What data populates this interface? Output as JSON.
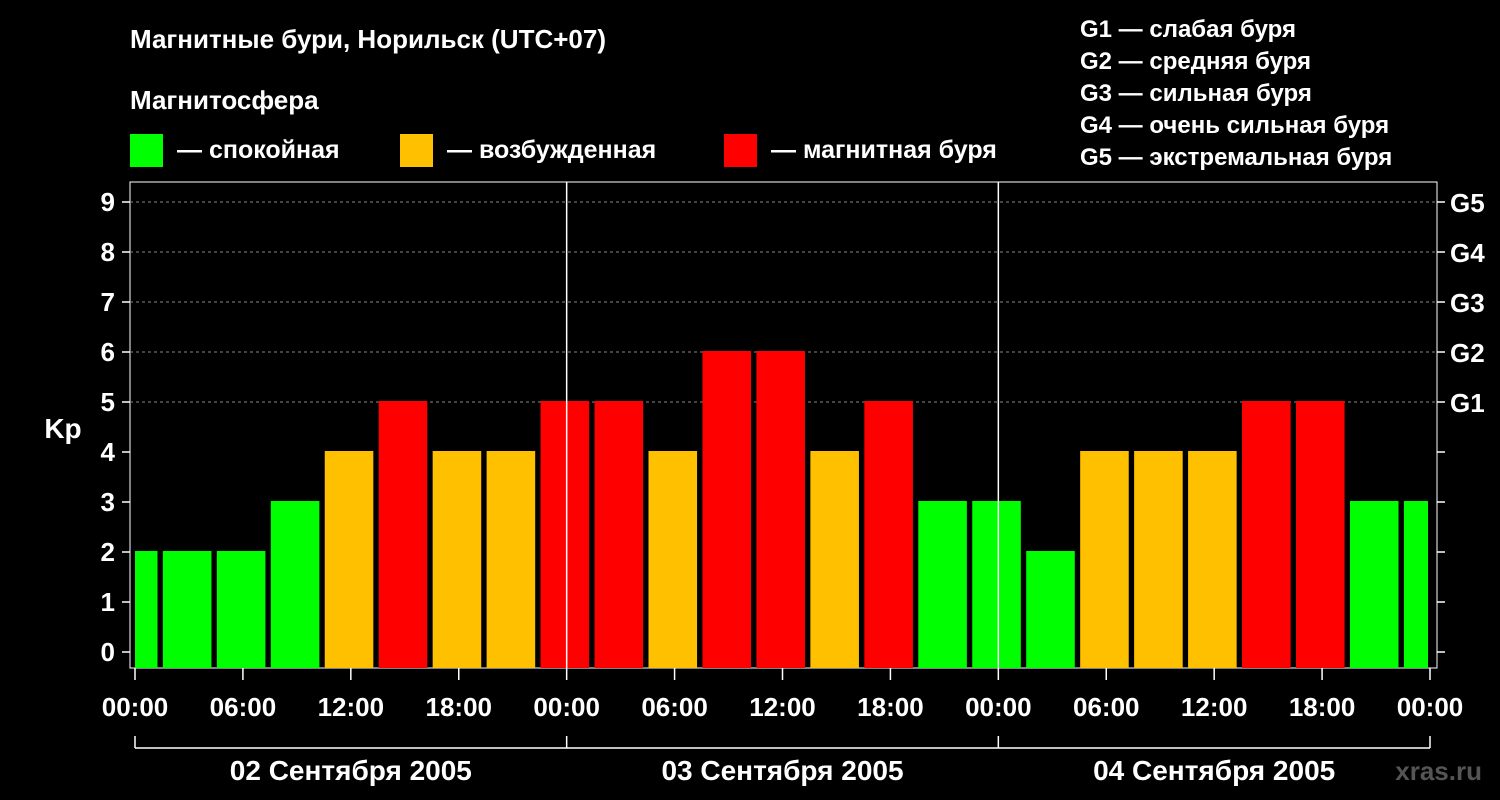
{
  "chart_data": {
    "type": "bar",
    "title": "Магнитные бури, Норильск (UTC+07)",
    "legend_title": "Магнитосфера",
    "legend": [
      {
        "label": "— спокойная",
        "color": "#00ff00"
      },
      {
        "label": "— возбужденная",
        "color": "#ffc000"
      },
      {
        "label": "— магнитная буря",
        "color": "#ff0000"
      }
    ],
    "g_scale": [
      "G1 — слабая буря",
      "G2 — средняя буря",
      "G3 — сильная буря",
      "G4 — очень сильная буря",
      "G5 — экстремальная буря"
    ],
    "ylabel": "Kp",
    "ylim": [
      0,
      9
    ],
    "yticks": [
      "0",
      "1",
      "2",
      "3",
      "4",
      "5",
      "6",
      "7",
      "8",
      "9"
    ],
    "right_ticks": [
      {
        "value": 5,
        "label": "G1"
      },
      {
        "value": 6,
        "label": "G2"
      },
      {
        "value": 7,
        "label": "G3"
      },
      {
        "value": 8,
        "label": "G4"
      },
      {
        "value": 9,
        "label": "G5"
      }
    ],
    "xticks": [
      "00:00",
      "06:00",
      "12:00",
      "18:00",
      "00:00",
      "06:00",
      "12:00",
      "18:00",
      "00:00",
      "06:00",
      "12:00",
      "18:00",
      "00:00"
    ],
    "days": [
      "02 Сентября 2005",
      "03 Сентября 2005",
      "04 Сентября 2005"
    ],
    "bar_interval_hours": 3,
    "values": [
      2,
      2,
      2,
      3,
      4,
      5,
      4,
      4,
      5,
      5,
      4,
      6,
      6,
      4,
      5,
      3,
      3,
      2,
      4,
      4,
      4,
      5,
      5,
      3,
      3
    ],
    "color_thresholds": {
      "quiet_max": 3,
      "active_max": 4
    },
    "grid": "dashed horizontal at 5–9",
    "watermark": "xras.ru"
  }
}
